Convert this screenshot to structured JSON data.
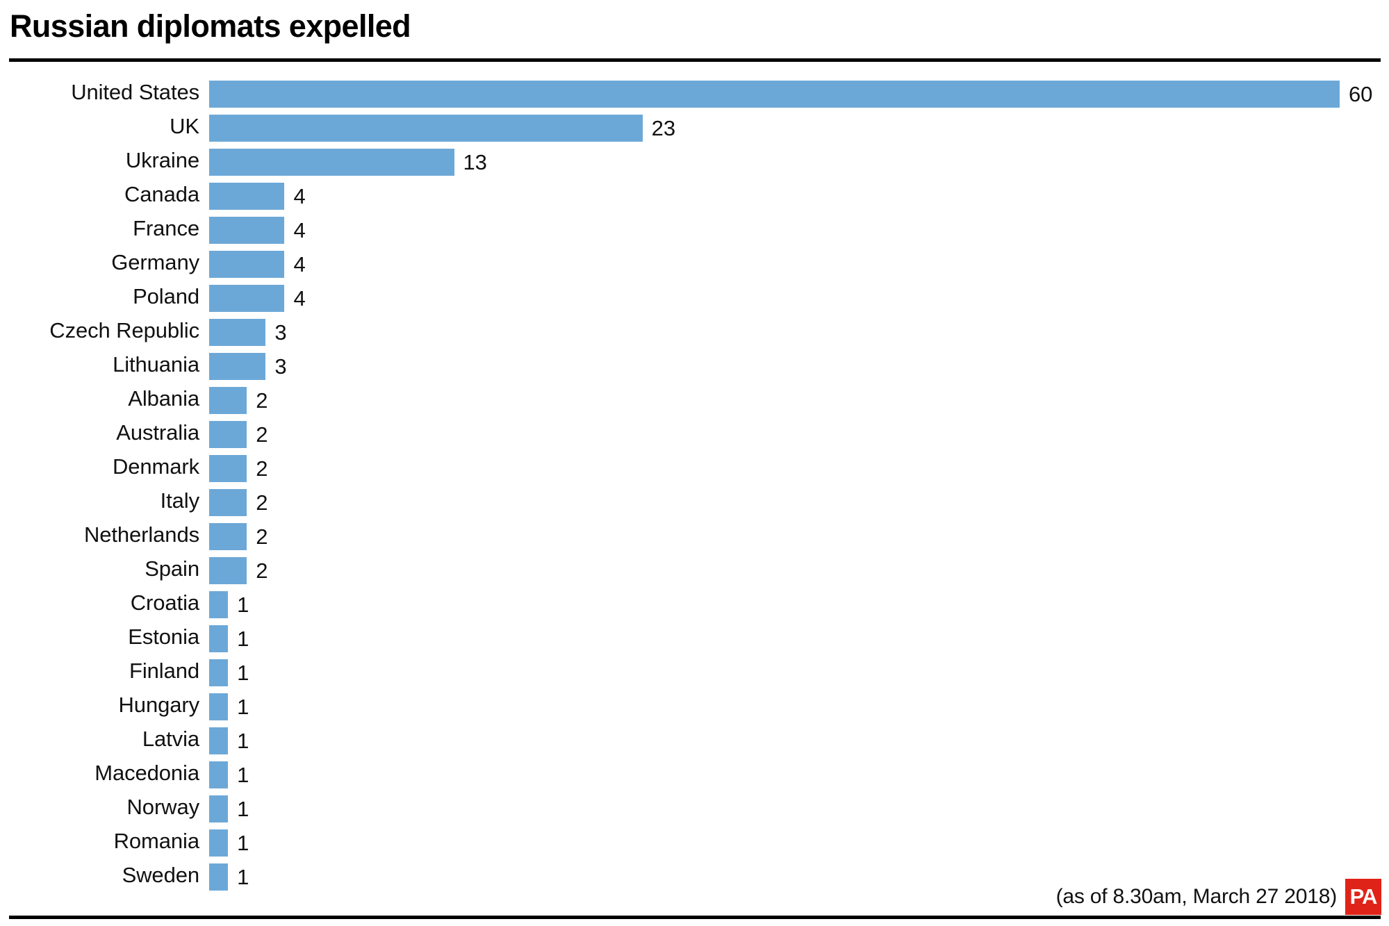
{
  "header": {
    "title": "Russian diplomats expelled"
  },
  "footer": {
    "note": "(as of 8.30am, March 27 2018)",
    "logo_text": "PA"
  },
  "colors": {
    "bar": "#6CA8D7",
    "logo_background": "#E02319",
    "rule": "#000000",
    "text": "#111111"
  },
  "chart_data": {
    "type": "bar",
    "orientation": "horizontal",
    "title": "Russian diplomats expelled",
    "subtitle": "(as of 8.30am, March 27 2018)",
    "xlabel": "",
    "ylabel": "",
    "xlim": [
      0,
      60
    ],
    "grid": false,
    "legend": false,
    "value_labels": true,
    "categories": [
      "United States",
      "UK",
      "Ukraine",
      "Canada",
      "France",
      "Germany",
      "Poland",
      "Czech Republic",
      "Lithuania",
      "Albania",
      "Australia",
      "Denmark",
      "Italy",
      "Netherlands",
      "Spain",
      "Croatia",
      "Estonia",
      "Finland",
      "Hungary",
      "Latvia",
      "Macedonia",
      "Norway",
      "Romania",
      "Sweden"
    ],
    "values": [
      60,
      23,
      13,
      4,
      4,
      4,
      4,
      3,
      3,
      2,
      2,
      2,
      2,
      2,
      2,
      1,
      1,
      1,
      1,
      1,
      1,
      1,
      1,
      1
    ],
    "rows": [
      {
        "label": "United States",
        "value": 60,
        "value_text": "60"
      },
      {
        "label": "UK",
        "value": 23,
        "value_text": "23"
      },
      {
        "label": "Ukraine",
        "value": 13,
        "value_text": "13"
      },
      {
        "label": "Canada",
        "value": 4,
        "value_text": "4"
      },
      {
        "label": "France",
        "value": 4,
        "value_text": "4"
      },
      {
        "label": "Germany",
        "value": 4,
        "value_text": "4"
      },
      {
        "label": "Poland",
        "value": 4,
        "value_text": "4"
      },
      {
        "label": "Czech Republic",
        "value": 3,
        "value_text": "3"
      },
      {
        "label": "Lithuania",
        "value": 3,
        "value_text": "3"
      },
      {
        "label": "Albania",
        "value": 2,
        "value_text": "2"
      },
      {
        "label": "Australia",
        "value": 2,
        "value_text": "2"
      },
      {
        "label": "Denmark",
        "value": 2,
        "value_text": "2"
      },
      {
        "label": "Italy",
        "value": 2,
        "value_text": "2"
      },
      {
        "label": "Netherlands",
        "value": 2,
        "value_text": "2"
      },
      {
        "label": "Spain",
        "value": 2,
        "value_text": "2"
      },
      {
        "label": "Croatia",
        "value": 1,
        "value_text": "1"
      },
      {
        "label": "Estonia",
        "value": 1,
        "value_text": "1"
      },
      {
        "label": "Finland",
        "value": 1,
        "value_text": "1"
      },
      {
        "label": "Hungary",
        "value": 1,
        "value_text": "1"
      },
      {
        "label": "Latvia",
        "value": 1,
        "value_text": "1"
      },
      {
        "label": "Macedonia",
        "value": 1,
        "value_text": "1"
      },
      {
        "label": "Norway",
        "value": 1,
        "value_text": "1"
      },
      {
        "label": "Romania",
        "value": 1,
        "value_text": "1"
      },
      {
        "label": "Sweden",
        "value": 1,
        "value_text": "1"
      }
    ]
  }
}
